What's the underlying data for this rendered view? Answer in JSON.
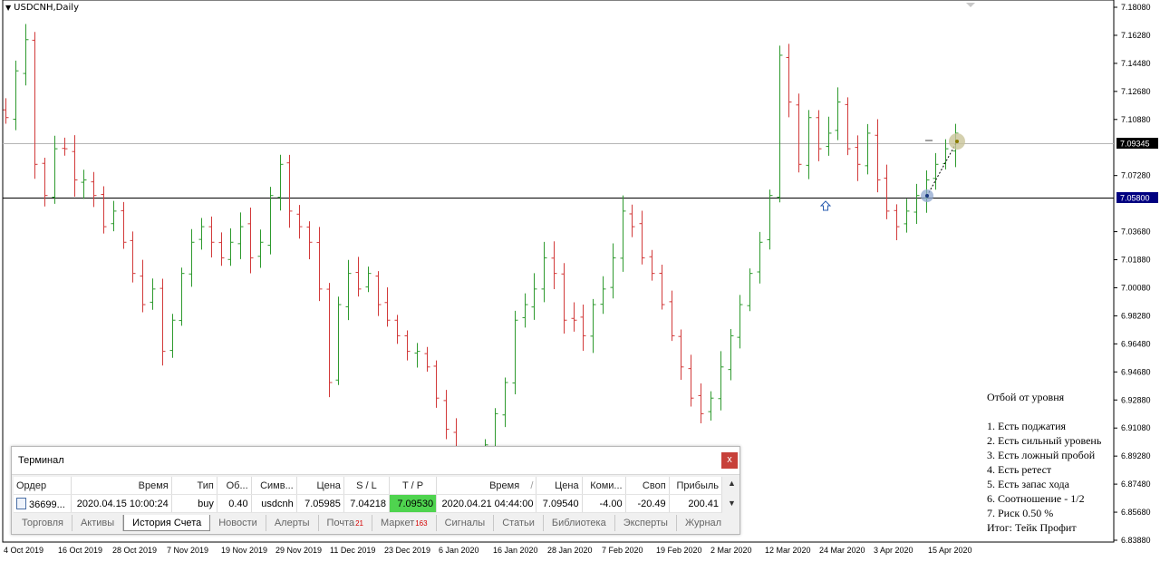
{
  "chart": {
    "symbol_label": "USDCNH,Daily",
    "price_labels": [
      "7.18080",
      "7.16280",
      "7.14480",
      "7.12680",
      "7.10880",
      "7.07280",
      "7.03680",
      "7.01880",
      "7.00080",
      "6.98280",
      "6.96480",
      "6.94680",
      "6.92880",
      "6.91080",
      "6.89280",
      "6.87480",
      "6.85680",
      "6.83880"
    ],
    "current_price": "7.09345",
    "level_price": "7.05800",
    "date_labels": [
      "4 Oct 2019",
      "16 Oct 2019",
      "28 Oct 2019",
      "7 Nov 2019",
      "19 Nov 2019",
      "29 Nov 2019",
      "11 Dec 2019",
      "23 Dec 2019",
      "6 Jan 2020",
      "16 Jan 2020",
      "28 Jan 2020",
      "7 Feb 2020",
      "19 Feb 2020",
      "2 Mar 2020",
      "12 Mar 2020",
      "24 Mar 2020",
      "3 Apr 2020",
      "15 Apr 2020"
    ],
    "colors": {
      "up": "#2e9a2e",
      "down": "#d23a3a",
      "level": "#000080",
      "current_label_bg": "#000000",
      "level_label_bg": "#000080"
    }
  },
  "chart_data": {
    "type": "ohlc",
    "title": "USDCNH,Daily",
    "ylim": [
      6.8388,
      7.1808
    ],
    "x_start": "4 Oct 2019",
    "x_end": "20 Apr 2020",
    "horizontal_lines": [
      7.09345,
      7.058
    ],
    "series": [
      {
        "name": "USDCNH",
        "close_path": [
          7.11,
          7.14,
          7.16,
          7.08,
          7.06,
          7.09,
          7.09,
          7.07,
          7.07,
          7.06,
          7.04,
          7.05,
          7.03,
          7.01,
          6.99,
          7.0,
          6.96,
          6.98,
          7.01,
          7.03,
          7.04,
          7.03,
          7.02,
          7.03,
          7.04,
          7.02,
          7.03,
          7.06,
          7.08,
          7.05,
          7.04,
          7.03,
          7.0,
          6.94,
          6.99,
          7.01,
          7.0,
          7.01,
          6.99,
          6.98,
          6.97,
          6.96,
          6.96,
          6.95,
          6.93,
          6.91,
          6.89,
          6.88,
          6.88,
          6.9,
          6.92,
          6.94,
          6.98,
          6.99,
          7.0,
          7.02,
          7.01,
          6.98,
          6.98,
          6.97,
          6.99,
          7.0,
          7.02,
          7.05,
          7.04,
          7.02,
          7.01,
          6.99,
          6.97,
          6.95,
          6.93,
          6.92,
          6.93,
          6.95,
          6.97,
          6.99,
          7.01,
          7.03,
          7.06,
          7.15,
          7.12,
          7.08,
          7.11,
          7.09,
          7.1,
          7.12,
          7.09,
          7.08,
          7.1,
          7.07,
          7.05,
          7.04,
          7.05,
          7.06,
          7.07,
          7.08,
          7.09,
          7.1
        ]
      }
    ]
  },
  "notes": {
    "title": "Отбой от уровня",
    "items": [
      "1. Есть поджатия",
      "2. Есть сильный уровень",
      "3. Есть ложный пробой",
      "4. Есть ретест",
      "5. Есть запас хода",
      "6. Соотношение - 1/2",
      "7. Риск 0.50 %"
    ],
    "result": "Итог: Тейк Профит"
  },
  "terminal": {
    "title": "Терминал",
    "close_label": "x",
    "headers": [
      "Ордер",
      "Время",
      "Тип",
      "Об...",
      "Симв...",
      "Цена",
      "S / L",
      "T / P",
      "Время",
      "Цена",
      "Коми...",
      "Своп",
      "Прибыль"
    ],
    "sort_indicator": "/",
    "row": {
      "order": "36699...",
      "open_time": "2020.04.15 10:00:24",
      "type": "buy",
      "volume": "0.40",
      "symbol": "usdcnh",
      "open_price": "7.05985",
      "sl": "7.04218",
      "tp": "7.09530",
      "close_time": "2020.04.21 04:44:00",
      "close_price": "7.09540",
      "commission": "-4.00",
      "swap": "-20.49",
      "profit": "200.41"
    },
    "tabs": [
      {
        "label": "Торговля",
        "count": ""
      },
      {
        "label": "Активы",
        "count": ""
      },
      {
        "label": "История Счета",
        "count": "",
        "active": true
      },
      {
        "label": "Новости",
        "count": ""
      },
      {
        "label": "Алерты",
        "count": ""
      },
      {
        "label": "Почта",
        "count": "21"
      },
      {
        "label": "Маркет",
        "count": "163"
      },
      {
        "label": "Сигналы",
        "count": ""
      },
      {
        "label": "Статьи",
        "count": ""
      },
      {
        "label": "Библиотека",
        "count": ""
      },
      {
        "label": "Эксперты",
        "count": ""
      },
      {
        "label": "Журнал",
        "count": ""
      }
    ]
  }
}
